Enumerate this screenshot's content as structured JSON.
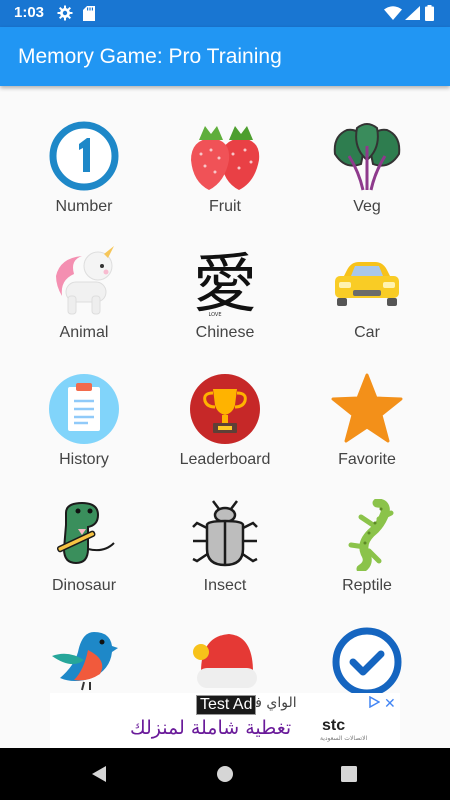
{
  "status_bar": {
    "time": "1:03",
    "icons": [
      "gear-icon",
      "sd-card-icon",
      "wifi-icon",
      "signal-icon",
      "battery-icon"
    ]
  },
  "app_bar": {
    "title": "Memory Game: Pro Training",
    "color": "#2196f3"
  },
  "categories": [
    {
      "label": "Number",
      "icon": "number-one-icon"
    },
    {
      "label": "Fruit",
      "icon": "strawberry-icon"
    },
    {
      "label": "Veg",
      "icon": "spinach-icon"
    },
    {
      "label": "Animal",
      "icon": "unicorn-icon"
    },
    {
      "label": "Chinese",
      "icon": "chinese-character-icon"
    },
    {
      "label": "Car",
      "icon": "car-icon"
    },
    {
      "label": "History",
      "icon": "clipboard-icon"
    },
    {
      "label": "Leaderboard",
      "icon": "trophy-icon"
    },
    {
      "label": "Favorite",
      "icon": "star-icon"
    },
    {
      "label": "Dinosaur",
      "icon": "dinosaur-icon"
    },
    {
      "label": "Insect",
      "icon": "beetle-icon"
    },
    {
      "label": "Reptile",
      "icon": "lizard-icon"
    },
    {
      "label": "",
      "icon": "bird-icon"
    },
    {
      "label": "",
      "icon": "santa-hat-icon"
    },
    {
      "label": "",
      "icon": "checkmark-icon"
    }
  ],
  "chinese_glyph": {
    "character": "愛",
    "caption": "LOVE"
  },
  "ad_banner": {
    "test_label": "Test Ad",
    "line1": "الواي فاي",
    "line2": "تغطية شاملة لمنزلك",
    "brand": "stc",
    "brand_sub": "الاتصالات السعودية",
    "close": "✕"
  },
  "nav_bar": {
    "buttons": [
      "back-icon",
      "home-icon",
      "recent-apps-icon"
    ]
  }
}
